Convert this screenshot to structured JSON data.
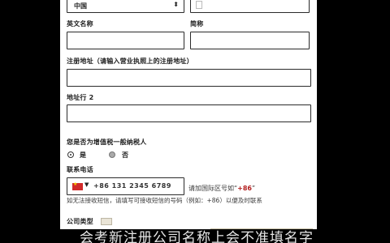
{
  "country_select": {
    "value": "中国",
    "arrow_icon": "chevron-updown-icon"
  },
  "labels": {
    "english_name": "英文名称",
    "abbreviation": "简称",
    "reg_address": "注册地址（请输入营业执照上的注册地址）",
    "address2": "地址行 2",
    "tax_question": "您是否为增值税一般纳税人",
    "phone": "联系电话",
    "company_type": "公司类型"
  },
  "radios": {
    "yes": "是",
    "no": "否"
  },
  "phone": {
    "flag_icon": "china-flag-icon",
    "value": "+86 131 2345 6789"
  },
  "hints": {
    "phone_format_prefix": "请加国际区号如",
    "phone_format_code": "+86",
    "phone_note_a": "如无法接收短信，请填写可接收短信的号码",
    "phone_note_b": "（例如：+86）",
    "phone_note_c": "以便及时联系"
  },
  "subtitle": "会考新注册公司名称上会不准填名字"
}
